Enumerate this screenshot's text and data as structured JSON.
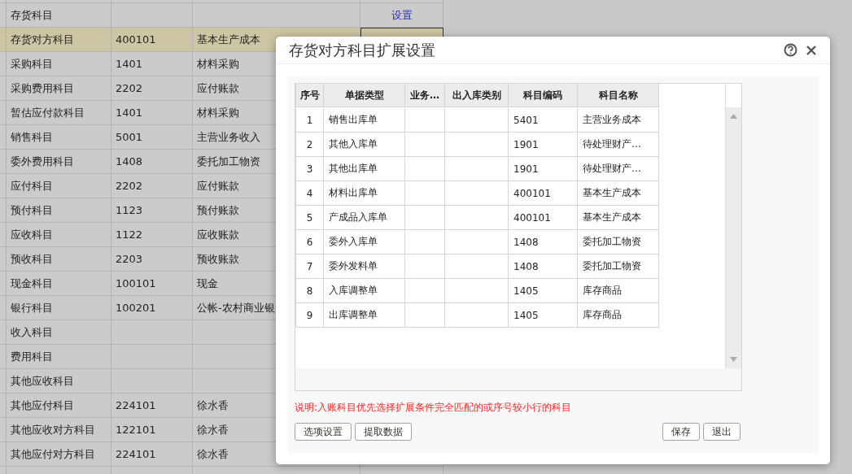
{
  "background_table": {
    "rows": [
      {
        "label": "",
        "code": "",
        "name": "",
        "action": "",
        "selected": false
      },
      {
        "label": "存货科目",
        "code": "",
        "name": "",
        "action": "设置",
        "selected": false
      },
      {
        "label": "存货对方科目",
        "code": "400101",
        "name": "基本生产成本",
        "action": "",
        "selected": true
      },
      {
        "label": "采购科目",
        "code": "1401",
        "name": "材料采购",
        "action": "",
        "selected": false
      },
      {
        "label": "采购费用科目",
        "code": "2202",
        "name": "应付账款",
        "action": "",
        "selected": false
      },
      {
        "label": "暂估应付款科目",
        "code": "1401",
        "name": "材料采购",
        "action": "",
        "selected": false
      },
      {
        "label": "销售科目",
        "code": "5001",
        "name": "主营业务收入",
        "action": "",
        "selected": false
      },
      {
        "label": "委外费用科目",
        "code": "1408",
        "name": "委托加工物资",
        "action": "",
        "selected": false
      },
      {
        "label": "应付科目",
        "code": "2202",
        "name": "应付账款",
        "action": "",
        "selected": false
      },
      {
        "label": "预付科目",
        "code": "1123",
        "name": "预付账款",
        "action": "",
        "selected": false
      },
      {
        "label": "应收科目",
        "code": "1122",
        "name": "应收账款",
        "action": "",
        "selected": false
      },
      {
        "label": "预收科目",
        "code": "2203",
        "name": "预收账款",
        "action": "",
        "selected": false
      },
      {
        "label": "现金科目",
        "code": "100101",
        "name": "现金",
        "action": "",
        "selected": false
      },
      {
        "label": "银行科目",
        "code": "100201",
        "name": "公帐-农村商业银",
        "action": "",
        "selected": false
      },
      {
        "label": "收入科目",
        "code": "",
        "name": "",
        "action": "",
        "selected": false
      },
      {
        "label": "费用科目",
        "code": "",
        "name": "",
        "action": "",
        "selected": false
      },
      {
        "label": "其他应收科目",
        "code": "",
        "name": "",
        "action": "",
        "selected": false
      },
      {
        "label": "其他应付科目",
        "code": "224101",
        "name": "徐水香",
        "action": "",
        "selected": false
      },
      {
        "label": "其他应收对方科目",
        "code": "122101",
        "name": "徐水香",
        "action": "",
        "selected": false
      },
      {
        "label": "其他应付对方科目",
        "code": "224101",
        "name": "徐水香",
        "action": "",
        "selected": false
      },
      {
        "label": "",
        "code": "",
        "name": "",
        "action": "",
        "selected": false
      }
    ]
  },
  "dialog": {
    "title": "存货对方科目扩展设置",
    "grid": {
      "columns": [
        "序号",
        "单据类型",
        "业务…",
        "出入库类别",
        "科目编码",
        "科目名称"
      ],
      "rows": [
        [
          "1",
          "销售出库单",
          "",
          "",
          "5401",
          "主营业务成本"
        ],
        [
          "2",
          "其他入库单",
          "",
          "",
          "1901",
          "待处理财产…"
        ],
        [
          "3",
          "其他出库单",
          "",
          "",
          "1901",
          "待处理财产…"
        ],
        [
          "4",
          "材料出库单",
          "",
          "",
          "400101",
          "基本生产成本"
        ],
        [
          "5",
          "产成品入库单",
          "",
          "",
          "400101",
          "基本生产成本"
        ],
        [
          "6",
          "委外入库单",
          "",
          "",
          "1408",
          "委托加工物资"
        ],
        [
          "7",
          "委外发料单",
          "",
          "",
          "1408",
          "委托加工物资"
        ],
        [
          "8",
          "入库调整单",
          "",
          "",
          "1405",
          "库存商品"
        ],
        [
          "9",
          "出库调整单",
          "",
          "",
          "1405",
          "库存商品"
        ]
      ]
    },
    "note": "说明:入账科目优先选择扩展条件完全匹配的或序号较小行的科目",
    "left_buttons": [
      "选项设置",
      "提取数据"
    ],
    "right_buttons": [
      "保存",
      "退出"
    ]
  }
}
